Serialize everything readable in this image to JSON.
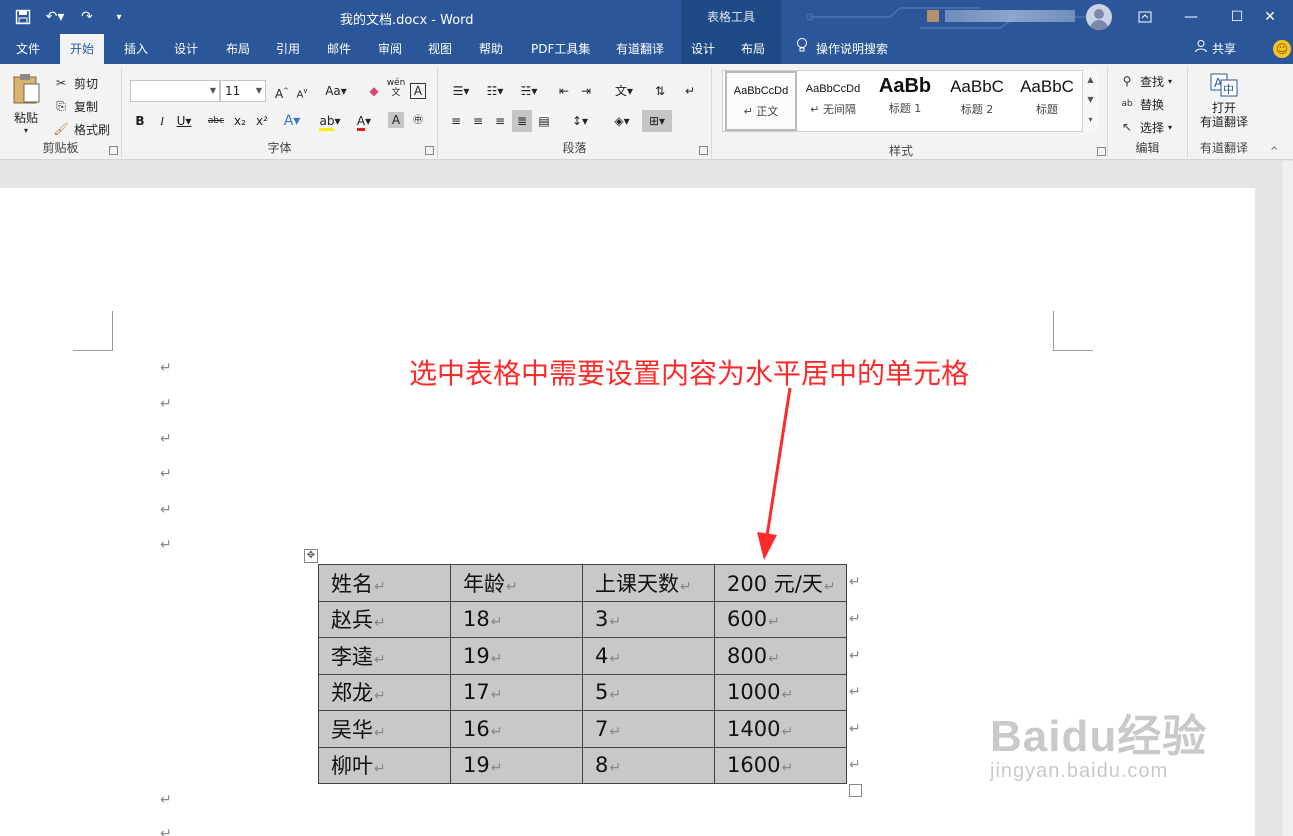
{
  "titlebar": {
    "doc_title": "我的文档.docx  -  Word",
    "context_group": "表格工具",
    "qat": [
      "save-icon",
      "undo-icon",
      "redo-icon",
      "customize-icon"
    ]
  },
  "tabs": [
    "文件",
    "开始",
    "插入",
    "设计",
    "布局",
    "引用",
    "邮件",
    "审阅",
    "视图",
    "帮助",
    "PDF工具集",
    "有道翻译",
    "设计",
    "布局"
  ],
  "active_tab_index": 1,
  "tell_me": "操作说明搜索",
  "share": "共享",
  "ribbon": {
    "clipboard": {
      "paste": "粘贴",
      "cut": "剪切",
      "copy": "复制",
      "format_painter": "格式刷",
      "label": "剪贴板"
    },
    "font": {
      "font_name": "",
      "font_size": "11",
      "label": "字体",
      "pinyin_top": "wén",
      "pinyin_bottom": "文"
    },
    "paragraph": {
      "label": "段落"
    },
    "styles": {
      "label": "样式",
      "items": [
        {
          "sample": "AaBbCcDd",
          "name": "↵ 正文"
        },
        {
          "sample": "AaBbCcDd",
          "name": "↵ 无间隔"
        },
        {
          "sample": "AaBb",
          "name": "标题 1"
        },
        {
          "sample": "AaBbC",
          "name": "标题 2"
        },
        {
          "sample": "AaBbC",
          "name": "标题"
        }
      ]
    },
    "editing": {
      "find": "查找",
      "replace": "替换",
      "select": "选择",
      "label": "编辑"
    },
    "youdao": {
      "open_line1": "打开",
      "open_line2": "有道翻译",
      "label": "有道翻译"
    }
  },
  "annotation": "选中表格中需要设置内容为水平居中的单元格",
  "paragraph_mark": "↵",
  "table": {
    "rows": [
      [
        "姓名",
        "年龄",
        "上课天数",
        "200 元/天"
      ],
      [
        "赵兵",
        "18",
        "3",
        "600"
      ],
      [
        "李逵",
        "19",
        "4",
        "800"
      ],
      [
        "郑龙",
        "17",
        "5",
        "1000"
      ],
      [
        "吴华",
        "16",
        "7",
        "1400"
      ],
      [
        "柳叶",
        "19",
        "8",
        "1600"
      ]
    ]
  },
  "watermark": {
    "main": "Baidu经验",
    "sub": "jingyan.baidu.com"
  },
  "colors": {
    "accent": "#2b579a",
    "annotation": "#ff2b2b",
    "cell_selected": "#c8c8c8"
  }
}
